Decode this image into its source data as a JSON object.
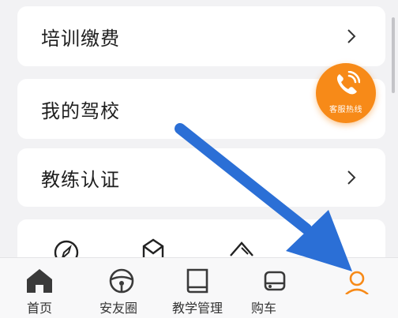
{
  "menu": {
    "items": [
      {
        "label": "培训缴费",
        "has_chevron": true
      },
      {
        "label": "我的驾校",
        "has_chevron": false
      },
      {
        "label": "教练认证",
        "has_chevron": true
      }
    ]
  },
  "quick_icons": [
    "compass-icon",
    "envelope-icon",
    "tag-icon",
    "partial-icon"
  ],
  "hotline": {
    "label": "客服热线",
    "icon": "phone-icon",
    "color": "#f78a18"
  },
  "tabbar": {
    "items": [
      {
        "label": "首页",
        "icon": "home-icon"
      },
      {
        "label": "安友圈",
        "icon": "steering-wheel-icon"
      },
      {
        "label": "教学管理",
        "icon": "book-icon"
      },
      {
        "label": "购车",
        "icon": "car-icon"
      },
      {
        "label": "",
        "icon": "profile-icon"
      }
    ]
  },
  "overlay": {
    "icon": "annotation-arrow-icon",
    "color": "#2b6fd6"
  }
}
